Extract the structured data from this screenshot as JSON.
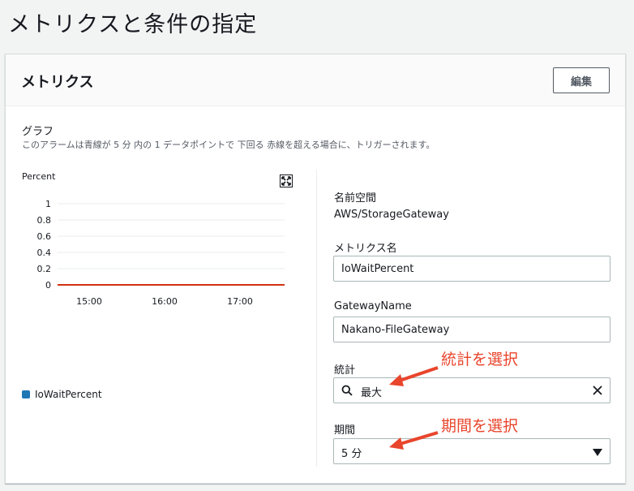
{
  "page": {
    "title": "メトリクスと条件の指定"
  },
  "metrics_panel": {
    "title": "メトリクス",
    "edit_label": "編集"
  },
  "graph": {
    "heading": "グラフ",
    "description": "このアラームは青線が 5 分 内の 1 データポイントで 下回る 赤線を超える場合に、トリガーされます。",
    "y_unit": "Percent",
    "legend_label": "IoWaitPercent"
  },
  "chart_data": {
    "type": "line",
    "ylabel": "Percent",
    "ylim": [
      0,
      1
    ],
    "y_ticks": [
      "1",
      "0.8",
      "0.6",
      "0.4",
      "0.2",
      "0"
    ],
    "x_ticks": [
      "15:00",
      "16:00",
      "17:00"
    ],
    "grid": true,
    "threshold": {
      "value": 0,
      "color": "#d13212"
    },
    "series": [
      {
        "name": "IoWaitPercent",
        "color": "#1f77b4",
        "values": []
      }
    ],
    "legend": "bottom-left"
  },
  "details": {
    "namespace_label": "名前空間",
    "namespace_value": "AWS/StorageGateway",
    "metric_name_label": "メトリクス名",
    "metric_name_value": "IoWaitPercent",
    "gateway_name_label": "GatewayName",
    "gateway_name_value": "Nakano-FileGateway",
    "statistic_label": "統計",
    "statistic_value": "最大",
    "period_label": "期間",
    "period_value": "5 分"
  },
  "annotations": {
    "statistic_note": "統計を選択",
    "period_note": "期間を選択",
    "color": "#e8452c"
  },
  "icons": {
    "expand": "expand-icon",
    "search": "search-icon",
    "clear": "close-icon",
    "caret": "caret-down-icon"
  }
}
